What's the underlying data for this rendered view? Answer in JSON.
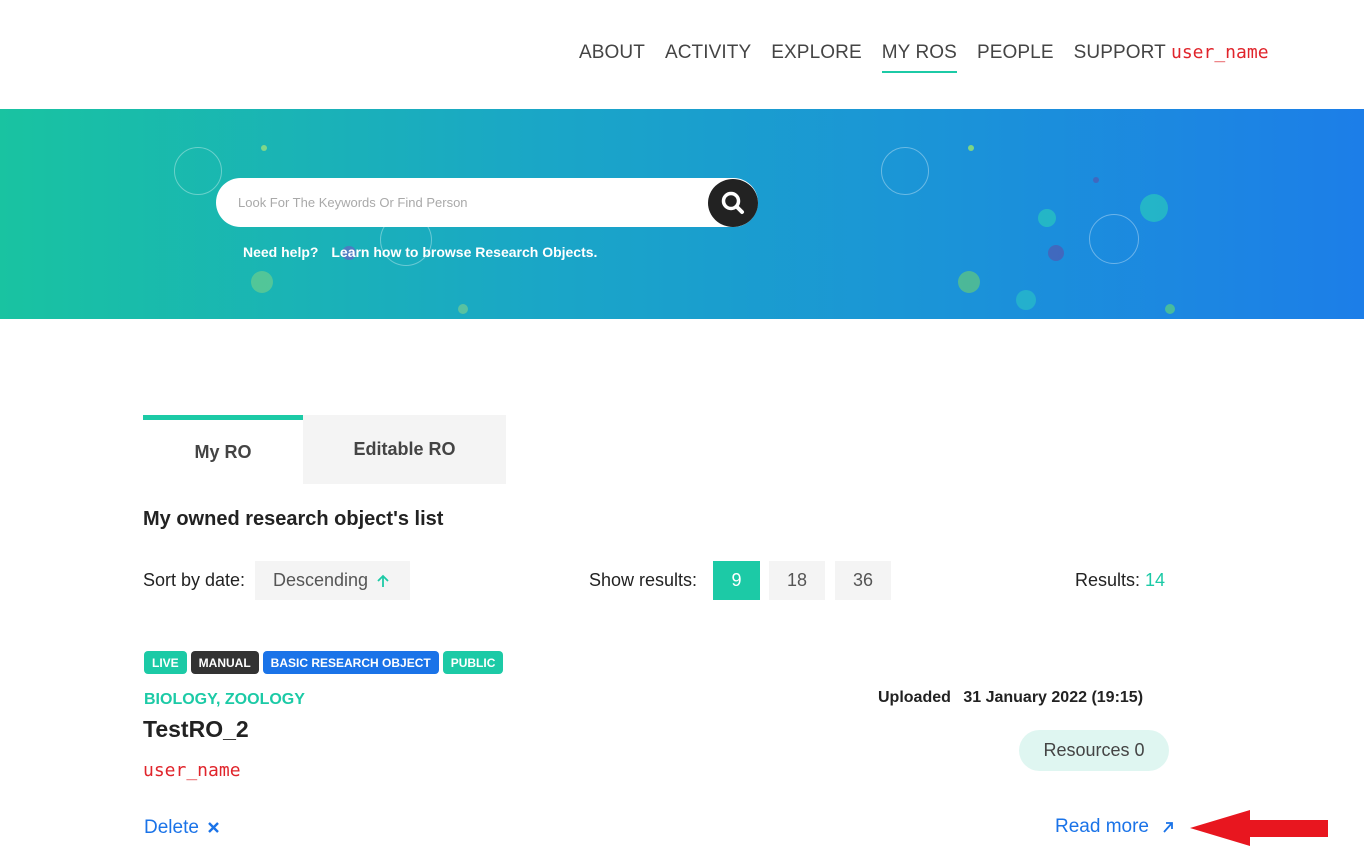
{
  "nav": {
    "items": [
      {
        "label": "ABOUT",
        "active": false
      },
      {
        "label": "ACTIVITY",
        "active": false
      },
      {
        "label": "EXPLORE",
        "active": false
      },
      {
        "label": "MY ROS",
        "active": true
      },
      {
        "label": "PEOPLE",
        "active": false
      },
      {
        "label": "SUPPORT",
        "active": false
      }
    ],
    "user_name": "user_name"
  },
  "hero": {
    "search_placeholder": "Look For The Keywords Or Find Person",
    "search_value": "",
    "help_label": "Need help?",
    "help_link": "Learn how to browse Research Objects."
  },
  "tabs": [
    {
      "label": "My RO",
      "active": true
    },
    {
      "label": "Editable RO",
      "active": false
    }
  ],
  "list_title": "My owned research object's list",
  "sort": {
    "label": "Sort by date:",
    "value": "Descending",
    "icon": "arrow-up-icon"
  },
  "show": {
    "label": "Show results:",
    "options": [
      "9",
      "18",
      "36"
    ],
    "selected": "9"
  },
  "results": {
    "label": "Results:",
    "count": "14"
  },
  "item": {
    "badges": [
      {
        "label": "LIVE",
        "color": "#1ccaa6"
      },
      {
        "label": "MANUAL",
        "color": "#333333"
      },
      {
        "label": "BASIC RESEARCH OBJECT",
        "color": "#1a73e8"
      },
      {
        "label": "PUBLIC",
        "color": "#1ccaa6"
      }
    ],
    "categories": "BIOLOGY, ZOOLOGY",
    "title": "TestRO_2",
    "owner": "user_name",
    "uploaded_label": "Uploaded",
    "uploaded_date": "31 January 2022 (19:15)",
    "resources": "Resources 0",
    "delete_label": "Delete",
    "read_more_label": "Read more"
  },
  "colors": {
    "accent": "#1ccaa6",
    "link": "#1a73e8",
    "username": "#e0242b",
    "annotation_arrow": "#e8161f"
  }
}
